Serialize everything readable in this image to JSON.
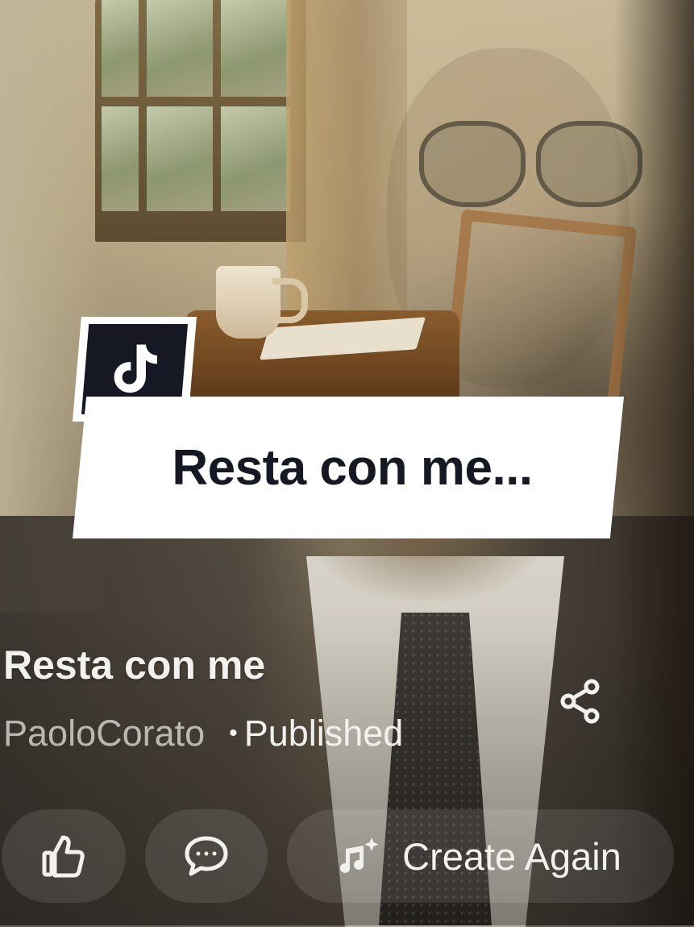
{
  "sticker": {
    "logo_icon": "tiktok-logo",
    "title": "Resta con me..."
  },
  "song": {
    "title": "Resta con me",
    "author": "PaoloCorato",
    "separator": "•",
    "status": "Published",
    "share_icon": "share-icon"
  },
  "actions": {
    "like_icon": "thumbs-up-icon",
    "comment_icon": "comment-icon",
    "create_icon": "music-sparkle-icon",
    "create_label": "Create Again"
  },
  "colors": {
    "card_bg": "#ffffff",
    "card_text": "#161823",
    "text_primary": "#f3f1ee"
  }
}
